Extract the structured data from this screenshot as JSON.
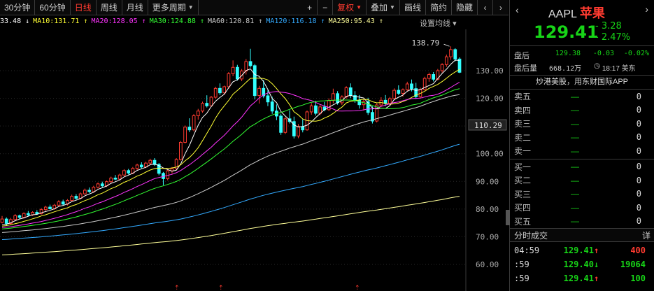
{
  "toolbar": {
    "periods": [
      "30分钟",
      "60分钟",
      "日线",
      "周线",
      "月线",
      "更多周期"
    ],
    "active_period": "日线",
    "zoom_in": "+",
    "zoom_out": "−",
    "adjust": "复权",
    "overlay": "叠加",
    "draw": "画线",
    "simple": "简约",
    "hide": "隐藏",
    "prev": "‹",
    "next": "›"
  },
  "ma_legend": {
    "items": [
      {
        "label": "33.48",
        "arrow": "↓",
        "color": "#ffffff"
      },
      {
        "label": "MA10:131.71",
        "arrow": "↑",
        "color": "#ffff33"
      },
      {
        "label": "MA20:128.05",
        "arrow": "↑",
        "color": "#ff33ff"
      },
      {
        "label": "MA30:124.88",
        "arrow": "↑",
        "color": "#33ff33"
      },
      {
        "label": "MA60:120.81",
        "arrow": "↑",
        "color": "#cccccc"
      },
      {
        "label": "MA120:116.18",
        "arrow": "↑",
        "color": "#33aaff"
      },
      {
        "label": "MA250:95.43",
        "arrow": "↑",
        "color": "#ffff99"
      }
    ],
    "settings_label": "设置均线",
    "settings_caret": "▾"
  },
  "chart_data": {
    "type": "candlestick",
    "y_axis_ticks": [
      60.0,
      70.0,
      80.0,
      90.0,
      100.0,
      110.0,
      120.0,
      130.0
    ],
    "ylim": [
      58,
      140
    ],
    "current_price_label": "110.29",
    "high_annotation": "138.79",
    "candles": [
      [
        75.2,
        77.5,
        74.8,
        76.4
      ],
      [
        76.4,
        77.0,
        73.9,
        74.8
      ],
      [
        74.8,
        76.8,
        74.3,
        76.2
      ],
      [
        76.2,
        78.2,
        75.9,
        77.6
      ],
      [
        77.6,
        78.0,
        76.5,
        77.0
      ],
      [
        77.0,
        78.8,
        76.6,
        78.4
      ],
      [
        78.4,
        79.3,
        77.4,
        77.9
      ],
      [
        77.9,
        79.2,
        77.5,
        78.8
      ],
      [
        78.8,
        79.6,
        77.9,
        78.3
      ],
      [
        78.3,
        80.4,
        78.0,
        79.8
      ],
      [
        79.8,
        81.2,
        79.3,
        80.7
      ],
      [
        80.7,
        81.6,
        79.8,
        80.1
      ],
      [
        80.1,
        81.9,
        79.7,
        81.4
      ],
      [
        81.4,
        83.2,
        81.0,
        82.6
      ],
      [
        82.6,
        83.4,
        81.2,
        81.8
      ],
      [
        81.8,
        83.6,
        81.3,
        83.1
      ],
      [
        83.1,
        85.2,
        82.8,
        84.6
      ],
      [
        84.6,
        85.4,
        83.3,
        83.9
      ],
      [
        83.9,
        86.0,
        83.5,
        85.5
      ],
      [
        85.5,
        87.4,
        85.0,
        86.8
      ],
      [
        86.8,
        87.8,
        85.8,
        86.3
      ],
      [
        86.3,
        88.4,
        85.9,
        87.9
      ],
      [
        87.9,
        89.6,
        87.4,
        89.1
      ],
      [
        89.1,
        89.9,
        87.9,
        88.4
      ],
      [
        88.4,
        90.3,
        88.0,
        89.9
      ],
      [
        89.9,
        91.7,
        89.4,
        91.2
      ],
      [
        91.2,
        92.3,
        90.4,
        90.8
      ],
      [
        90.8,
        92.8,
        90.3,
        92.3
      ],
      [
        92.3,
        94.4,
        91.9,
        93.9
      ],
      [
        93.9,
        94.5,
        92.5,
        93.0
      ],
      [
        93.0,
        95.2,
        92.6,
        94.7
      ],
      [
        94.7,
        96.4,
        94.1,
        95.9
      ],
      [
        95.9,
        96.9,
        94.7,
        95.2
      ],
      [
        95.2,
        97.1,
        94.8,
        96.6
      ],
      [
        96.6,
        98.2,
        96.1,
        97.6
      ],
      [
        97.6,
        98.4,
        95.6,
        96.1
      ],
      [
        96.1,
        96.6,
        92.2,
        92.9
      ],
      [
        92.9,
        93.4,
        88.6,
        91.0
      ],
      [
        91.0,
        94.5,
        90.4,
        93.8
      ],
      [
        93.8,
        95.2,
        92.8,
        94.6
      ],
      [
        94.6,
        98.4,
        94.2,
        97.9
      ],
      [
        97.9,
        104.6,
        97.5,
        104.1
      ],
      [
        104.1,
        110.2,
        103.7,
        109.6
      ],
      [
        109.6,
        112.8,
        107.8,
        108.6
      ],
      [
        108.6,
        114.3,
        108.1,
        113.7
      ],
      [
        113.7,
        116.2,
        112.3,
        115.4
      ],
      [
        115.4,
        118.8,
        114.8,
        118.2
      ],
      [
        118.2,
        121.1,
        116.7,
        117.3
      ],
      [
        117.3,
        120.9,
        116.9,
        120.4
      ],
      [
        120.4,
        124.2,
        119.8,
        123.6
      ],
      [
        123.6,
        125.4,
        121.2,
        122.0
      ],
      [
        122.0,
        124.6,
        121.4,
        124.2
      ],
      [
        124.2,
        129.5,
        123.5,
        128.9
      ],
      [
        128.9,
        133.7,
        128.0,
        131.2
      ],
      [
        131.2,
        132.1,
        126.4,
        127.0
      ],
      [
        127.0,
        130.6,
        126.2,
        129.9
      ],
      [
        129.9,
        134.2,
        128.6,
        133.3
      ],
      [
        133.3,
        137.9,
        131.1,
        131.8
      ],
      [
        131.8,
        132.4,
        119.6,
        121.0
      ],
      [
        121.0,
        124.5,
        118.1,
        123.6
      ],
      [
        123.6,
        126.6,
        120.2,
        120.9
      ],
      [
        120.9,
        122.9,
        117.2,
        118.7
      ],
      [
        118.7,
        120.6,
        114.4,
        115.4
      ],
      [
        115.4,
        117.8,
        112.1,
        113.6
      ],
      [
        113.6,
        114.4,
        106.8,
        107.7
      ],
      [
        107.7,
        113.2,
        107.1,
        112.6
      ],
      [
        112.6,
        115.7,
        110.9,
        111.6
      ],
      [
        111.6,
        113.4,
        105.5,
        106.4
      ],
      [
        106.4,
        110.7,
        105.6,
        109.8
      ],
      [
        109.8,
        112.4,
        107.7,
        108.6
      ],
      [
        108.6,
        115.6,
        108.3,
        115.1
      ],
      [
        115.1,
        118.3,
        114.1,
        117.3
      ],
      [
        117.3,
        119.1,
        113.8,
        114.6
      ],
      [
        114.6,
        117.8,
        113.9,
        116.9
      ],
      [
        116.9,
        118.7,
        115.3,
        115.9
      ],
      [
        115.9,
        120.0,
        115.4,
        119.2
      ],
      [
        119.2,
        123.5,
        118.2,
        121.7
      ],
      [
        121.7,
        122.6,
        117.7,
        118.4
      ],
      [
        118.4,
        121.1,
        117.6,
        120.5
      ],
      [
        120.5,
        124.4,
        119.9,
        123.8
      ],
      [
        123.8,
        125.4,
        120.1,
        121.0
      ],
      [
        121.0,
        122.6,
        118.4,
        119.3
      ],
      [
        119.3,
        121.2,
        116.3,
        117.7
      ],
      [
        117.7,
        119.8,
        115.6,
        118.8
      ],
      [
        118.8,
        120.2,
        114.0,
        114.9
      ],
      [
        114.9,
        117.1,
        110.9,
        111.8
      ],
      [
        111.8,
        118.2,
        111.3,
        117.6
      ],
      [
        117.6,
        120.4,
        116.9,
        119.3
      ],
      [
        119.3,
        121.2,
        117.2,
        118.1
      ],
      [
        118.1,
        120.5,
        117.3,
        119.9
      ],
      [
        119.9,
        123.6,
        119.4,
        122.9
      ],
      [
        122.9,
        124.7,
        121.2,
        121.8
      ],
      [
        121.8,
        123.6,
        120.6,
        123.1
      ],
      [
        123.1,
        126.0,
        122.4,
        125.2
      ],
      [
        125.2,
        126.8,
        122.5,
        123.5
      ],
      [
        123.5,
        125.6,
        119.8,
        120.6
      ],
      [
        120.6,
        123.9,
        120.0,
        123.2
      ],
      [
        123.2,
        127.8,
        122.8,
        127.2
      ],
      [
        127.2,
        129.3,
        126.0,
        128.6
      ],
      [
        128.6,
        129.5,
        126.1,
        126.9
      ],
      [
        126.9,
        130.6,
        126.5,
        130.0
      ],
      [
        130.0,
        132.7,
        129.3,
        132.2
      ],
      [
        132.2,
        135.8,
        131.4,
        135.0
      ],
      [
        135.0,
        138.79,
        133.9,
        137.6
      ],
      [
        137.6,
        138.1,
        133.4,
        134.2
      ],
      [
        134.2,
        134.8,
        129.1,
        129.41
      ]
    ],
    "ma_series": [
      {
        "name": "MA5",
        "color": "#ffffff",
        "values": [
          75.5,
          75.8,
          76.1,
          76.4,
          76.8,
          77.0,
          77.3,
          77.7,
          78.2,
          78.6,
          79.1,
          79.5,
          80.1,
          80.7,
          81.2,
          81.8,
          82.3,
          82.9,
          83.5,
          84.2,
          84.8,
          85.6,
          86.3,
          87.0,
          87.8,
          88.5,
          89.2,
          90.0,
          90.8,
          91.6,
          92.3,
          93.1,
          93.9,
          94.6,
          95.3,
          95.9,
          95.6,
          94.8,
          94.3,
          94.1,
          94.9,
          97.2,
          100.8,
          104.5,
          108.6,
          111.7,
          114.2,
          116.8,
          118.8,
          120.8,
          122.4,
          123.7,
          125.2,
          126.4,
          127.3,
          128.8,
          130.5,
          130.7,
          128.6,
          126.7,
          124.5,
          122.6,
          119.7,
          117.6,
          115.2,
          113.4,
          111.8,
          110.5,
          109.5,
          109.5,
          110.4,
          112.8,
          114.2,
          116.0,
          116.8,
          117.5,
          118.3,
          118.9,
          119.8,
          120.8,
          121.2,
          120.8,
          120.6,
          119.9,
          118.7,
          117.0,
          116.4,
          116.0,
          116.4,
          117.4,
          118.7,
          120.0,
          121.2,
          122.5,
          123.0,
          122.9,
          122.8,
          123.8,
          124.4,
          125.4,
          126.9,
          128.4,
          129.7,
          131.4,
          132.4,
          132.6
        ],
        "smooth": true
      },
      {
        "name": "MA10",
        "color": "#ffff33",
        "values": []
      },
      {
        "name": "MA20",
        "color": "#ff33ff",
        "values": []
      },
      {
        "name": "MA30",
        "color": "#33ff33",
        "values": []
      },
      {
        "name": "MA60",
        "color": "#cccccc",
        "values": []
      },
      {
        "name": "MA120",
        "color": "#33aaff",
        "values": []
      },
      {
        "name": "MA250",
        "color": "#ffff99",
        "values": []
      }
    ]
  },
  "quote": {
    "symbol": "AAPL",
    "name_cn": "苹果",
    "last_price": "129.41",
    "change": "- 3.28",
    "change_pct": "- 2.47%",
    "back_icon": "‹",
    "close_icon": "›"
  },
  "after_hours": {
    "label": "盘后",
    "price": "129.38",
    "change": "-0.03",
    "change_pct": "-0.02%",
    "vol_label": "盘后量",
    "volume": "668.12万",
    "time": "18:17 美东"
  },
  "promo": "炒港美股，用东财国际APP",
  "order_book": {
    "asks": [
      {
        "label": "卖五",
        "price": "—",
        "vol": "0"
      },
      {
        "label": "卖四",
        "price": "—",
        "vol": "0"
      },
      {
        "label": "卖三",
        "price": "—",
        "vol": "0"
      },
      {
        "label": "卖二",
        "price": "—",
        "vol": "0"
      },
      {
        "label": "卖一",
        "price": "—",
        "vol": "0"
      }
    ],
    "bids": [
      {
        "label": "买一",
        "price": "—",
        "vol": "0"
      },
      {
        "label": "买二",
        "price": "—",
        "vol": "0"
      },
      {
        "label": "买三",
        "price": "—",
        "vol": "0"
      },
      {
        "label": "买四",
        "price": "—",
        "vol": "0"
      },
      {
        "label": "买五",
        "price": "—",
        "vol": "0"
      }
    ]
  },
  "ticks": {
    "title": "分时成交",
    "detail": "详",
    "rows": [
      {
        "time": "04:59",
        "price": "129.41",
        "dir": "up",
        "vol": "400",
        "vol_color": "red"
      },
      {
        "time": ":59",
        "price": "129.40",
        "dir": "down",
        "vol": "19064",
        "vol_color": "green"
      },
      {
        "time": ":59",
        "price": "129.41",
        "dir": "up",
        "vol": "100",
        "vol_color": "green"
      }
    ]
  }
}
